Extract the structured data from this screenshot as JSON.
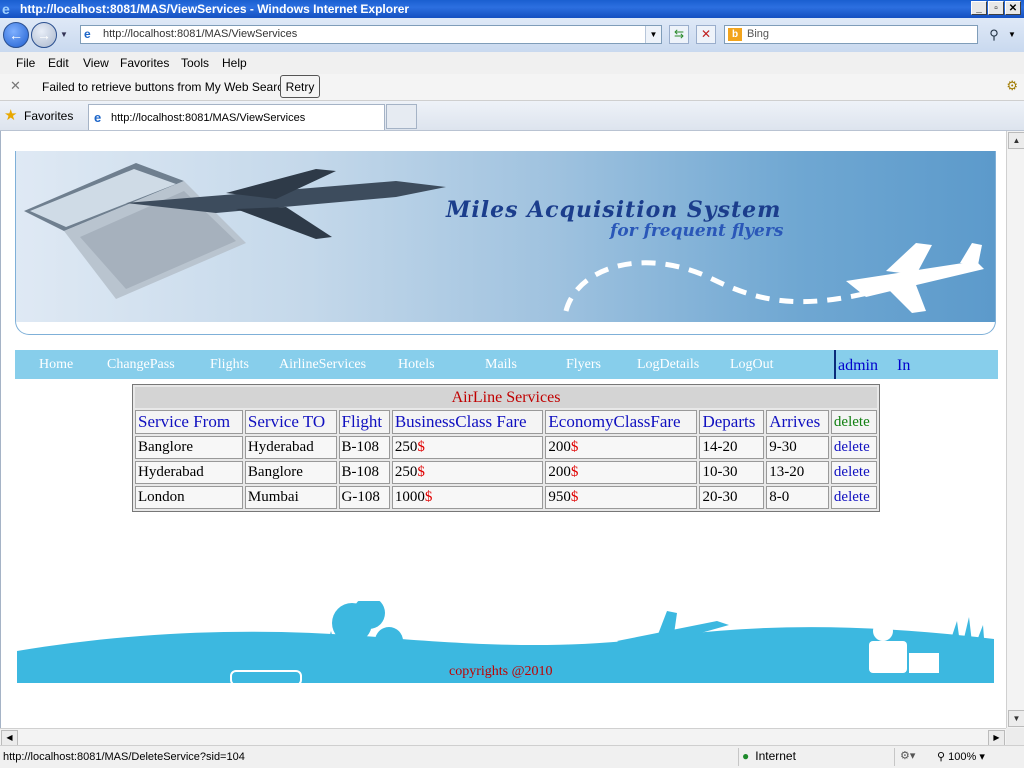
{
  "window": {
    "title": "http://localhost:8081/MAS/ViewServices - Windows Internet Explorer",
    "min": "_",
    "max": "▫",
    "close": "✕"
  },
  "address": {
    "url": "http://localhost:8081/MAS/ViewServices",
    "search_placeholder": "Bing"
  },
  "menu": [
    "File",
    "Edit",
    "View",
    "Favorites",
    "Tools",
    "Help"
  ],
  "notification": {
    "message": "Failed to retrieve buttons from My Web Search.",
    "retry_label": "Retry"
  },
  "favorites": {
    "label": "Favorites",
    "tab_title": "http://localhost:8081/MAS/ViewServices"
  },
  "banner": {
    "title": "Miles Acquisition System",
    "subtitle": "for frequent flyers"
  },
  "nav": {
    "items": [
      "Home",
      "ChangePass",
      "Flights",
      "AirlineServices",
      "Hotels",
      "Mails",
      "Flyers",
      "LogDetails",
      "LogOut"
    ],
    "user": "admin",
    "status": "In"
  },
  "services": {
    "caption": "AirLine Services",
    "headers": [
      "Service From",
      "Service TO",
      "Flight",
      "BusinessClass Fare",
      "EconomyClassFare",
      "Departs",
      "Arrives",
      "delete"
    ],
    "currency": "$",
    "rows": [
      {
        "from": "Banglore",
        "to": "Hyderabad",
        "flight": "B-108",
        "business": "250",
        "economy": "200",
        "departs": "14-20",
        "arrives": "9-30",
        "action": "delete"
      },
      {
        "from": "Hyderabad",
        "to": "Banglore",
        "flight": "B-108",
        "business": "250",
        "economy": "200",
        "departs": "10-30",
        "arrives": "13-20",
        "action": "delete"
      },
      {
        "from": "London",
        "to": "Mumbai",
        "flight": "G-108",
        "business": "1000",
        "economy": "950",
        "departs": "20-30",
        "arrives": "8-0",
        "action": "delete"
      }
    ]
  },
  "footer": {
    "copyright": "copyrights @2010"
  },
  "status": {
    "text": "http://localhost:8081/MAS/DeleteService?sid=104",
    "zone": "Internet",
    "zoom": "100%"
  },
  "colors": {
    "nav_bg": "#87ceeb",
    "footer_scene": "#3cb8e0",
    "caption_red": "#c00000",
    "header_blue": "#1010c0"
  }
}
